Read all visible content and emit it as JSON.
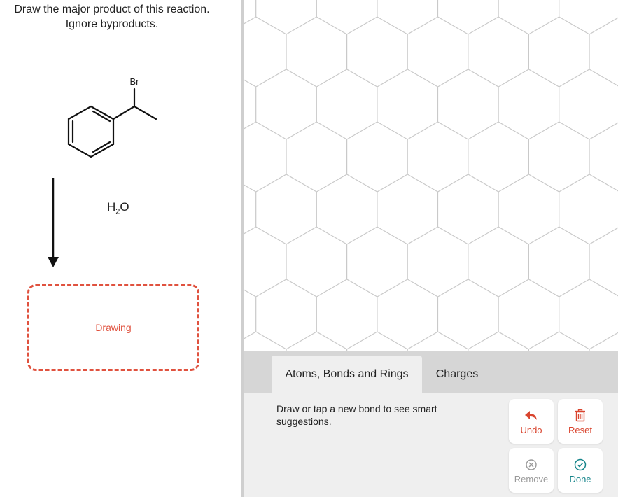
{
  "question": {
    "line1": "Draw the major product of this reaction.",
    "line2": "Ignore byproducts."
  },
  "reactant": {
    "substituent_label": "Br"
  },
  "reagent": {
    "prefix": "H",
    "subscript": "2",
    "suffix": "O"
  },
  "answer_box": {
    "label": "Drawing"
  },
  "editor": {
    "tabs": [
      {
        "label": "Atoms, Bonds and Rings",
        "active": true
      },
      {
        "label": "Charges",
        "active": false
      }
    ],
    "hint": "Draw or tap a new bond to see smart suggestions.",
    "buttons": {
      "undo": "Undo",
      "reset": "Reset",
      "remove": "Remove",
      "done": "Done"
    }
  },
  "colors": {
    "accent_red": "#e0523f",
    "button_red": "#d9452f",
    "done_teal": "#15848a",
    "disabled_gray": "#9a9a9a"
  }
}
